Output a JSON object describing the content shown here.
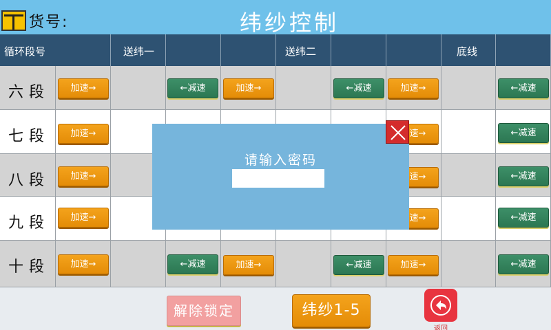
{
  "header": {
    "item_label": "货号:",
    "title": "纬纱控制"
  },
  "grid": {
    "col_header_first": "循环段号",
    "col_headers": [
      "送纬一",
      "",
      "",
      "送纬二",
      "",
      "",
      "底线",
      ""
    ],
    "accel_label": "加速→",
    "decel_label": "←减速",
    "rows": [
      {
        "label": "六段"
      },
      {
        "label": "七段"
      },
      {
        "label": "八段"
      },
      {
        "label": "九段"
      },
      {
        "label": "十段"
      }
    ]
  },
  "dialog": {
    "title": "请输入密码",
    "input_value": ""
  },
  "footer": {
    "unlock_label": "解除锁定",
    "weft_label": "纬纱1-5",
    "back_label": "返回"
  },
  "colors": {
    "title_bar": "#6fc1ea",
    "header_row": "#2e5272",
    "accel": "#f09a12",
    "decel": "#2f7d57",
    "dialog": "#76b5dc",
    "close": "#d42c2c"
  }
}
